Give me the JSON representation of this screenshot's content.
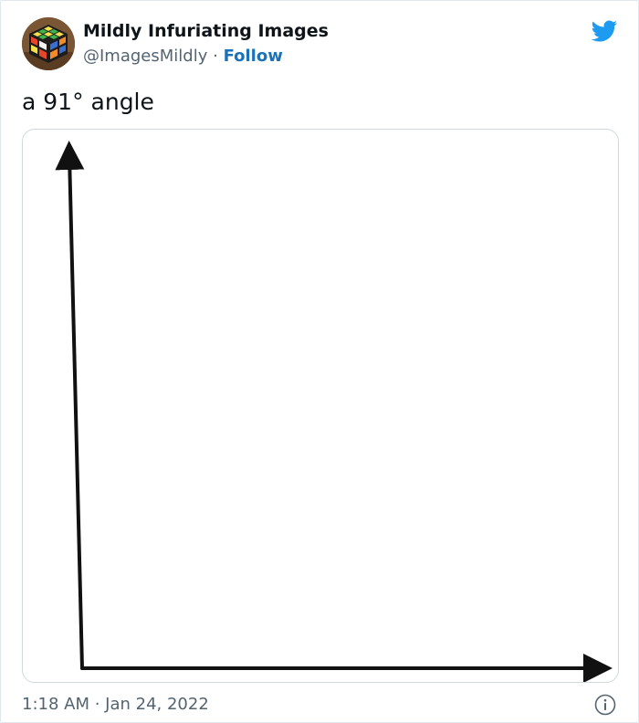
{
  "tweet": {
    "author_name": "Mildly Infuriating Images",
    "handle": "@ImagesMildly",
    "separator": "·",
    "follow_label": "Follow",
    "text": "a 91° angle",
    "timestamp": "1:18 AM · Jan 24, 2022"
  },
  "icons": {
    "brand": "twitter-bird-icon",
    "info": "info-icon",
    "avatar": "rubiks-cube-avatar"
  },
  "colors": {
    "twitter_blue": "#1d9bf0",
    "follow_link": "#1b72b8",
    "secondary_text": "#536471",
    "border": "#cfd9de"
  }
}
